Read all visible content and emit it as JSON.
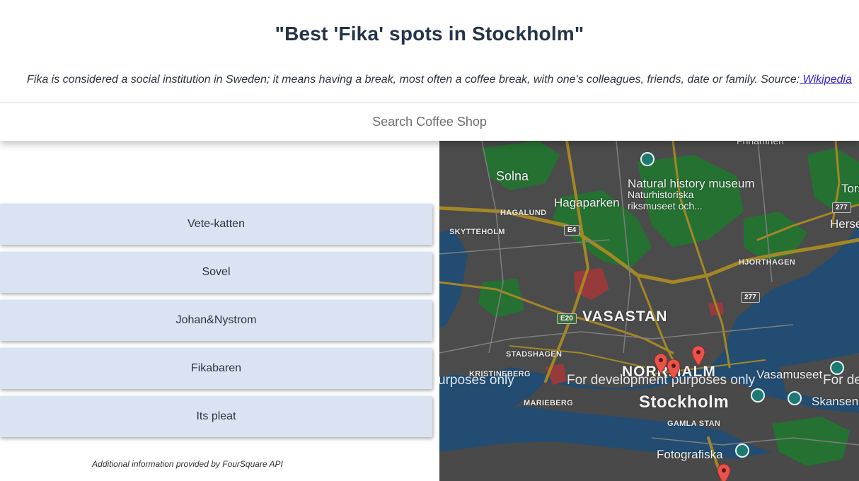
{
  "header": {
    "title": "\"Best 'Fika' spots in Stockholm\"",
    "subtitle_text": "Fika is considered a social institution in Sweden; it means having a break, most often a coffee break, with one's colleagues, friends, date or family. Source:",
    "source_link": " Wikipedia"
  },
  "search": {
    "placeholder": "Search Coffee Shop",
    "value": ""
  },
  "coffee_shops": [
    {
      "label": "Vete-katten"
    },
    {
      "label": "Sovel"
    },
    {
      "label": "Johan&Nystrom"
    },
    {
      "label": "Fikabaren"
    },
    {
      "label": "Its pleat"
    }
  ],
  "footer": {
    "attribution": "Additional information provided by FourSquare API"
  },
  "map": {
    "labels": {
      "solna": "Solna",
      "hagaparken": "Hagaparken",
      "hagalund": "HAGALUND",
      "skytteholm": "SKYTTEHOLM",
      "natural_history": "Natural history museum",
      "naturhistoriska_1": "Naturhistoriska",
      "naturhistoriska_2": "riksmuseet och...",
      "hjorthagen": "HJORTHAGEN",
      "vasastan": "VASASTAN",
      "stadshagen": "STADSHAGEN",
      "kristineberg": "KRISTINEBERG",
      "norrmalm": "NORRMALM",
      "vasamuseet": "Vasamuseet",
      "skansen": "Skansen",
      "marieberg": "MARIEBERG",
      "stockholm": "Stockholm",
      "gamla_stan": "GAMLA STAN",
      "fotografiska": "Fotografiska",
      "frankrike_top": "Frihamnen",
      "tors": "Tors",
      "hers": "Herse",
      "dev_watermark_1": "urposes only",
      "dev_watermark_2": "For development purposes only",
      "dev_watermark_3": "For de"
    },
    "road_shields": {
      "e4": "E4",
      "e20": "E20",
      "r277a": "277",
      "r277b": "277"
    },
    "colors": {
      "water": "#2a5d8c",
      "land": "#5c5c5c",
      "park": "#2e8a3e",
      "road": "#c9a52e",
      "pin": "#e8534a"
    },
    "marker_count": 4
  }
}
